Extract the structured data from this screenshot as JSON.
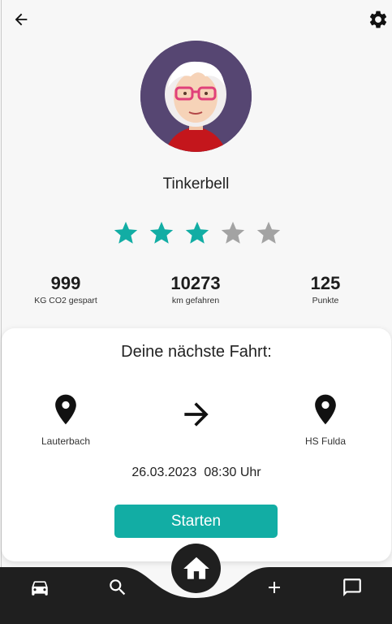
{
  "header": {
    "back_icon": "arrow-back-icon",
    "settings_icon": "gear-icon"
  },
  "profile": {
    "username": "Tinkerbell",
    "rating": {
      "value": 3,
      "max": 5,
      "filled_color": "#12ada4",
      "empty_color": "#a3a3a3"
    }
  },
  "stats": [
    {
      "value": "999",
      "label": "KG CO2 gespart"
    },
    {
      "value": "10273",
      "label": "km gefahren"
    },
    {
      "value": "125",
      "label": "Punkte"
    }
  ],
  "next_ride": {
    "title": "Deine nächste Fahrt:",
    "from": "Lauterbach",
    "to": "HS Fulda",
    "date": "26.03.2023",
    "time": "08:30 Uhr",
    "start_label": "Starten"
  },
  "colors": {
    "accent": "#12ada4",
    "navbar": "#1f1f1f"
  },
  "nav": {
    "items": [
      "car-icon",
      "search-icon",
      "home-icon",
      "plus-icon",
      "chat-icon"
    ]
  }
}
